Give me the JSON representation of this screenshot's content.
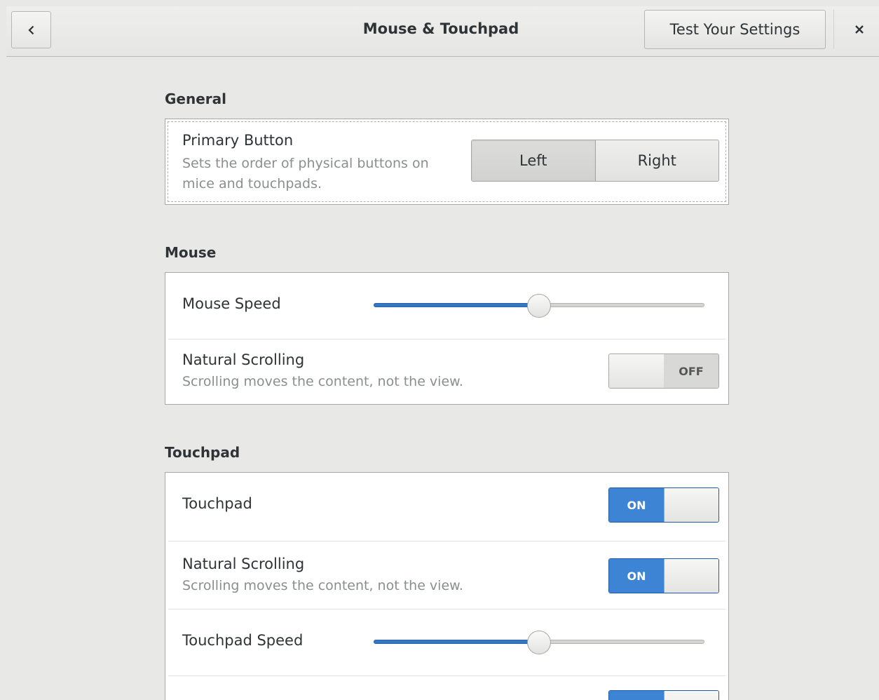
{
  "window": {
    "title": "Mouse & Touchpad",
    "test_button_label": "Test Your Settings"
  },
  "general": {
    "heading": "General",
    "primary_button": {
      "label": "Primary Button",
      "description_line1": "Sets the order of physical buttons on",
      "description_line2": "mice and touchpads.",
      "options": [
        "Left",
        "Right"
      ],
      "selected": "Left"
    }
  },
  "mouse": {
    "heading": "Mouse",
    "speed": {
      "label": "Mouse Speed",
      "value": 0.5
    },
    "natural_scrolling": {
      "label": "Natural Scrolling",
      "description": "Scrolling moves the content, not the view.",
      "state": "OFF"
    }
  },
  "touchpad": {
    "heading": "Touchpad",
    "touchpad_toggle": {
      "label": "Touchpad",
      "state": "ON"
    },
    "natural_scrolling": {
      "label": "Natural Scrolling",
      "description": "Scrolling moves the content, not the view.",
      "state": "ON"
    },
    "speed": {
      "label": "Touchpad Speed",
      "value": 0.5
    },
    "next_row_switch_state": "ON"
  },
  "colors": {
    "accent": "#3d84d4",
    "window_bg": "#e8e8e7",
    "frame_bg": "#ffffff"
  }
}
